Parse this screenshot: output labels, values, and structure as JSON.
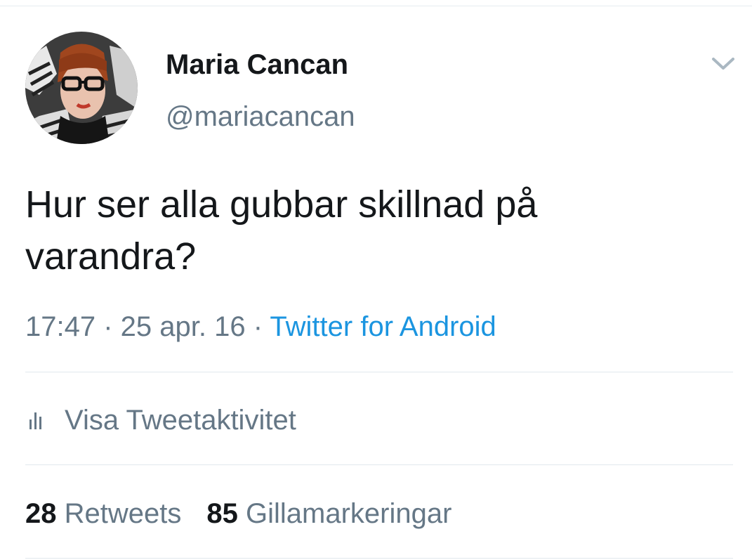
{
  "user": {
    "display_name": "Maria Cancan",
    "handle": "@mariacancan"
  },
  "tweet": {
    "text_line1": "Hur ser alla gubbar skillnad på",
    "text_line2": "varandra?",
    "time": "17:47",
    "separator": " · ",
    "date": "25 apr. 16",
    "source": "Twitter for Android"
  },
  "activity": {
    "label": "Visa Tweetaktivitet"
  },
  "stats": {
    "retweets_count": "28",
    "retweets_label": "Retweets",
    "likes_count": "85",
    "likes_label": "Gillamarkeringar"
  },
  "icons": {
    "caret": "chevron-down-icon",
    "activity": "bar-chart-icon"
  },
  "colors": {
    "text": "#14171a",
    "secondary": "#657786",
    "link": "#1b95e0",
    "divider": "#e1e8ed"
  }
}
